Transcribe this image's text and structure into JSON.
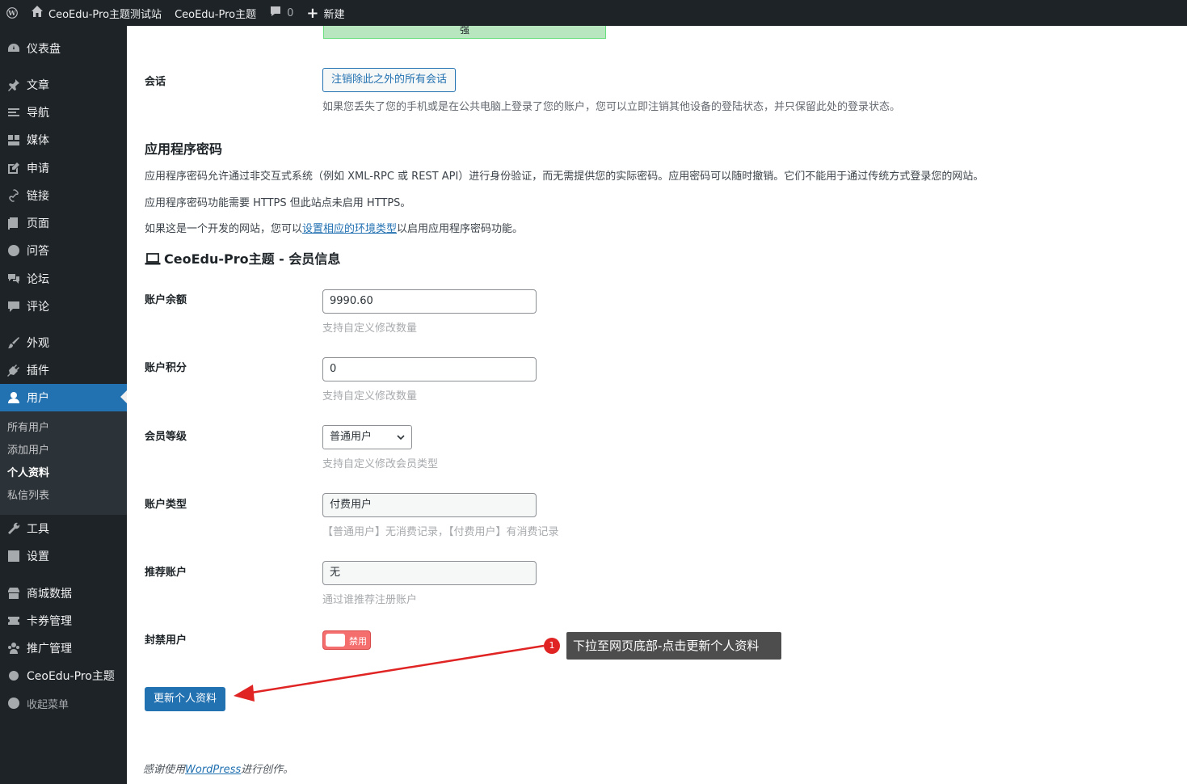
{
  "adminbar": {
    "site_name": "CeoEdu-Pro主题测试站",
    "theme": "CeoEdu-Pro主题",
    "comments_count": "0",
    "new_label": "新建"
  },
  "sidebar": {
    "items": [
      {
        "label": "仪表盘",
        "icon": "dashboard-icon"
      },
      {
        "label": "文章",
        "icon": "pin-icon"
      },
      {
        "label": "导航",
        "icon": "menu-icon"
      },
      {
        "label": "媒体",
        "icon": "media-icon"
      },
      {
        "label": "申请",
        "icon": "edit-icon"
      },
      {
        "label": "链接",
        "icon": "link-icon"
      },
      {
        "label": "页面",
        "icon": "page-icon"
      },
      {
        "label": "问答",
        "icon": "question-icon"
      },
      {
        "label": "论坛",
        "icon": "forum-icon"
      },
      {
        "label": "评论",
        "icon": "comment-icon"
      },
      {
        "label": "外观",
        "icon": "brush-icon"
      },
      {
        "label": "插件",
        "icon": "plugin-icon"
      },
      {
        "label": "用户",
        "icon": "user-icon"
      },
      {
        "label": "工具",
        "icon": "wrench-icon"
      },
      {
        "label": "设置",
        "icon": "settings-icon"
      },
      {
        "label": "商城数据",
        "icon": "store-icon"
      },
      {
        "label": "卡券管理",
        "icon": "coupon-icon"
      },
      {
        "label": "推广管理",
        "icon": "group-icon"
      },
      {
        "label": "CeoEdu-Pro主题",
        "icon": "gear-icon"
      },
      {
        "label": "收起菜单",
        "icon": "collapse-icon"
      }
    ],
    "submenu": [
      "所有用户",
      "添加用户",
      "个人资料",
      "私信列表"
    ]
  },
  "password": {
    "strength": "强"
  },
  "sessions": {
    "label": "会话",
    "button": "注销除此之外的所有会话",
    "desc": "如果您丢失了您的手机或是在公共电脑上登录了您的账户，您可以立即注销其他设备的登陆状态，并只保留此处的登录状态。"
  },
  "app_passwords": {
    "title": "应用程序密码",
    "p1": "应用程序密码允许通过非交互式系统（例如 XML-RPC 或 REST API）进行身份验证，而无需提供您的实际密码。应用密码可以随时撤销。它们不能用于通过传统方式登录您的网站。",
    "p2": "应用程序密码功能需要 HTTPS 但此站点未启用 HTTPS。",
    "p3_before": "如果这是一个开发的网站，您可以",
    "p3_link": "设置相应的环境类型",
    "p3_after": "以启用应用程序密码功能。"
  },
  "member": {
    "title": "CeoEdu-Pro主题 - 会员信息",
    "balance_label": "账户余额",
    "balance_value": "9990.60",
    "balance_hint": "支持自定义修改数量",
    "points_label": "账户积分",
    "points_value": "0",
    "points_hint": "支持自定义修改数量",
    "level_label": "会员等级",
    "level_value": "普通用户",
    "level_hint": "支持自定义修改会员类型",
    "type_label": "账户类型",
    "type_value": "付费用户",
    "type_hint": "【普通用户】无消费记录，【付费用户】有消费记录",
    "referrer_label": "推荐账户",
    "referrer_value": "无",
    "referrer_hint": "通过谁推荐注册账户",
    "ban_label": "封禁用户",
    "ban_toggle": "禁用"
  },
  "submit_label": "更新个人资料",
  "annotation": {
    "step": "1",
    "text": "下拉至网页底部-点击更新个人资料",
    "color": "#e02424"
  },
  "footer": {
    "before": "感谢使用",
    "link": "WordPress",
    "after": "进行创作。"
  }
}
